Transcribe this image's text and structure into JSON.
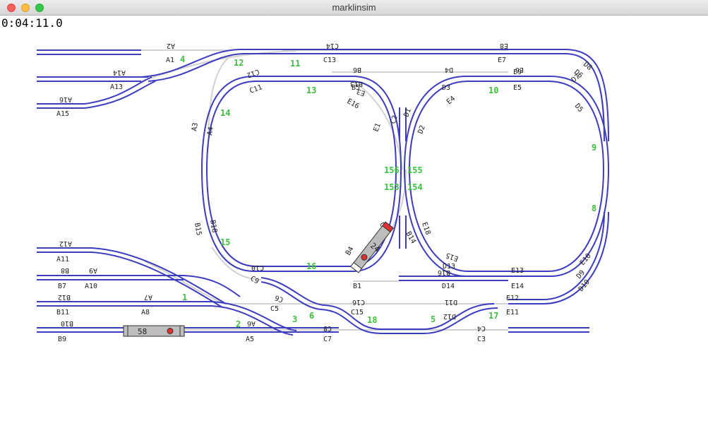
{
  "window": {
    "title": "marklinsim",
    "clock": "0:04:11.0"
  },
  "colors": {
    "track_active": "#3c3cc0",
    "track_inactive": "#d2d2d2",
    "block_number": "#3fbf3f",
    "label": "#222222",
    "train_body": "#bdbdbd",
    "train_head": "#e03030"
  },
  "blocks": [
    "1",
    "2",
    "3",
    "4",
    "5",
    "6",
    "8",
    "9",
    "10",
    "11",
    "12",
    "13",
    "14",
    "15",
    "16",
    "17",
    "18",
    "153",
    "154",
    "155",
    "156"
  ],
  "sensors_upright": [
    "A1",
    "A5",
    "A8",
    "A10",
    "A11",
    "A13",
    "A15",
    "B1",
    "B5",
    "B7",
    "B9",
    "B11",
    "B14",
    "C3",
    "C5",
    "C7",
    "C11",
    "C13",
    "C15",
    "D2",
    "D3",
    "D5",
    "D7",
    "D14",
    "E1",
    "E4",
    "E5",
    "E7",
    "E11",
    "E13",
    "E14",
    "E16",
    "E18",
    "A4",
    "A3",
    "B15",
    "B18",
    "C1",
    "C2",
    "B4",
    "D1",
    "D6",
    "D8",
    "D9",
    "D10",
    "D13",
    "E9",
    "E10",
    "E12",
    "C9"
  ],
  "sensors_flipped": [
    "A2",
    "A14",
    "A16",
    "A12",
    "B8",
    "A9",
    "B12",
    "A7",
    "B10",
    "A6",
    "C14",
    "B6",
    "D4",
    "E6",
    "E8",
    "C12",
    "E3",
    "E15",
    "B16",
    "C10",
    "C6",
    "C16",
    "C8",
    "D11",
    "C4",
    "D12",
    "B13"
  ],
  "trains": [
    {
      "id": "58",
      "label": "58"
    },
    {
      "id": "24",
      "label": "24"
    }
  ]
}
